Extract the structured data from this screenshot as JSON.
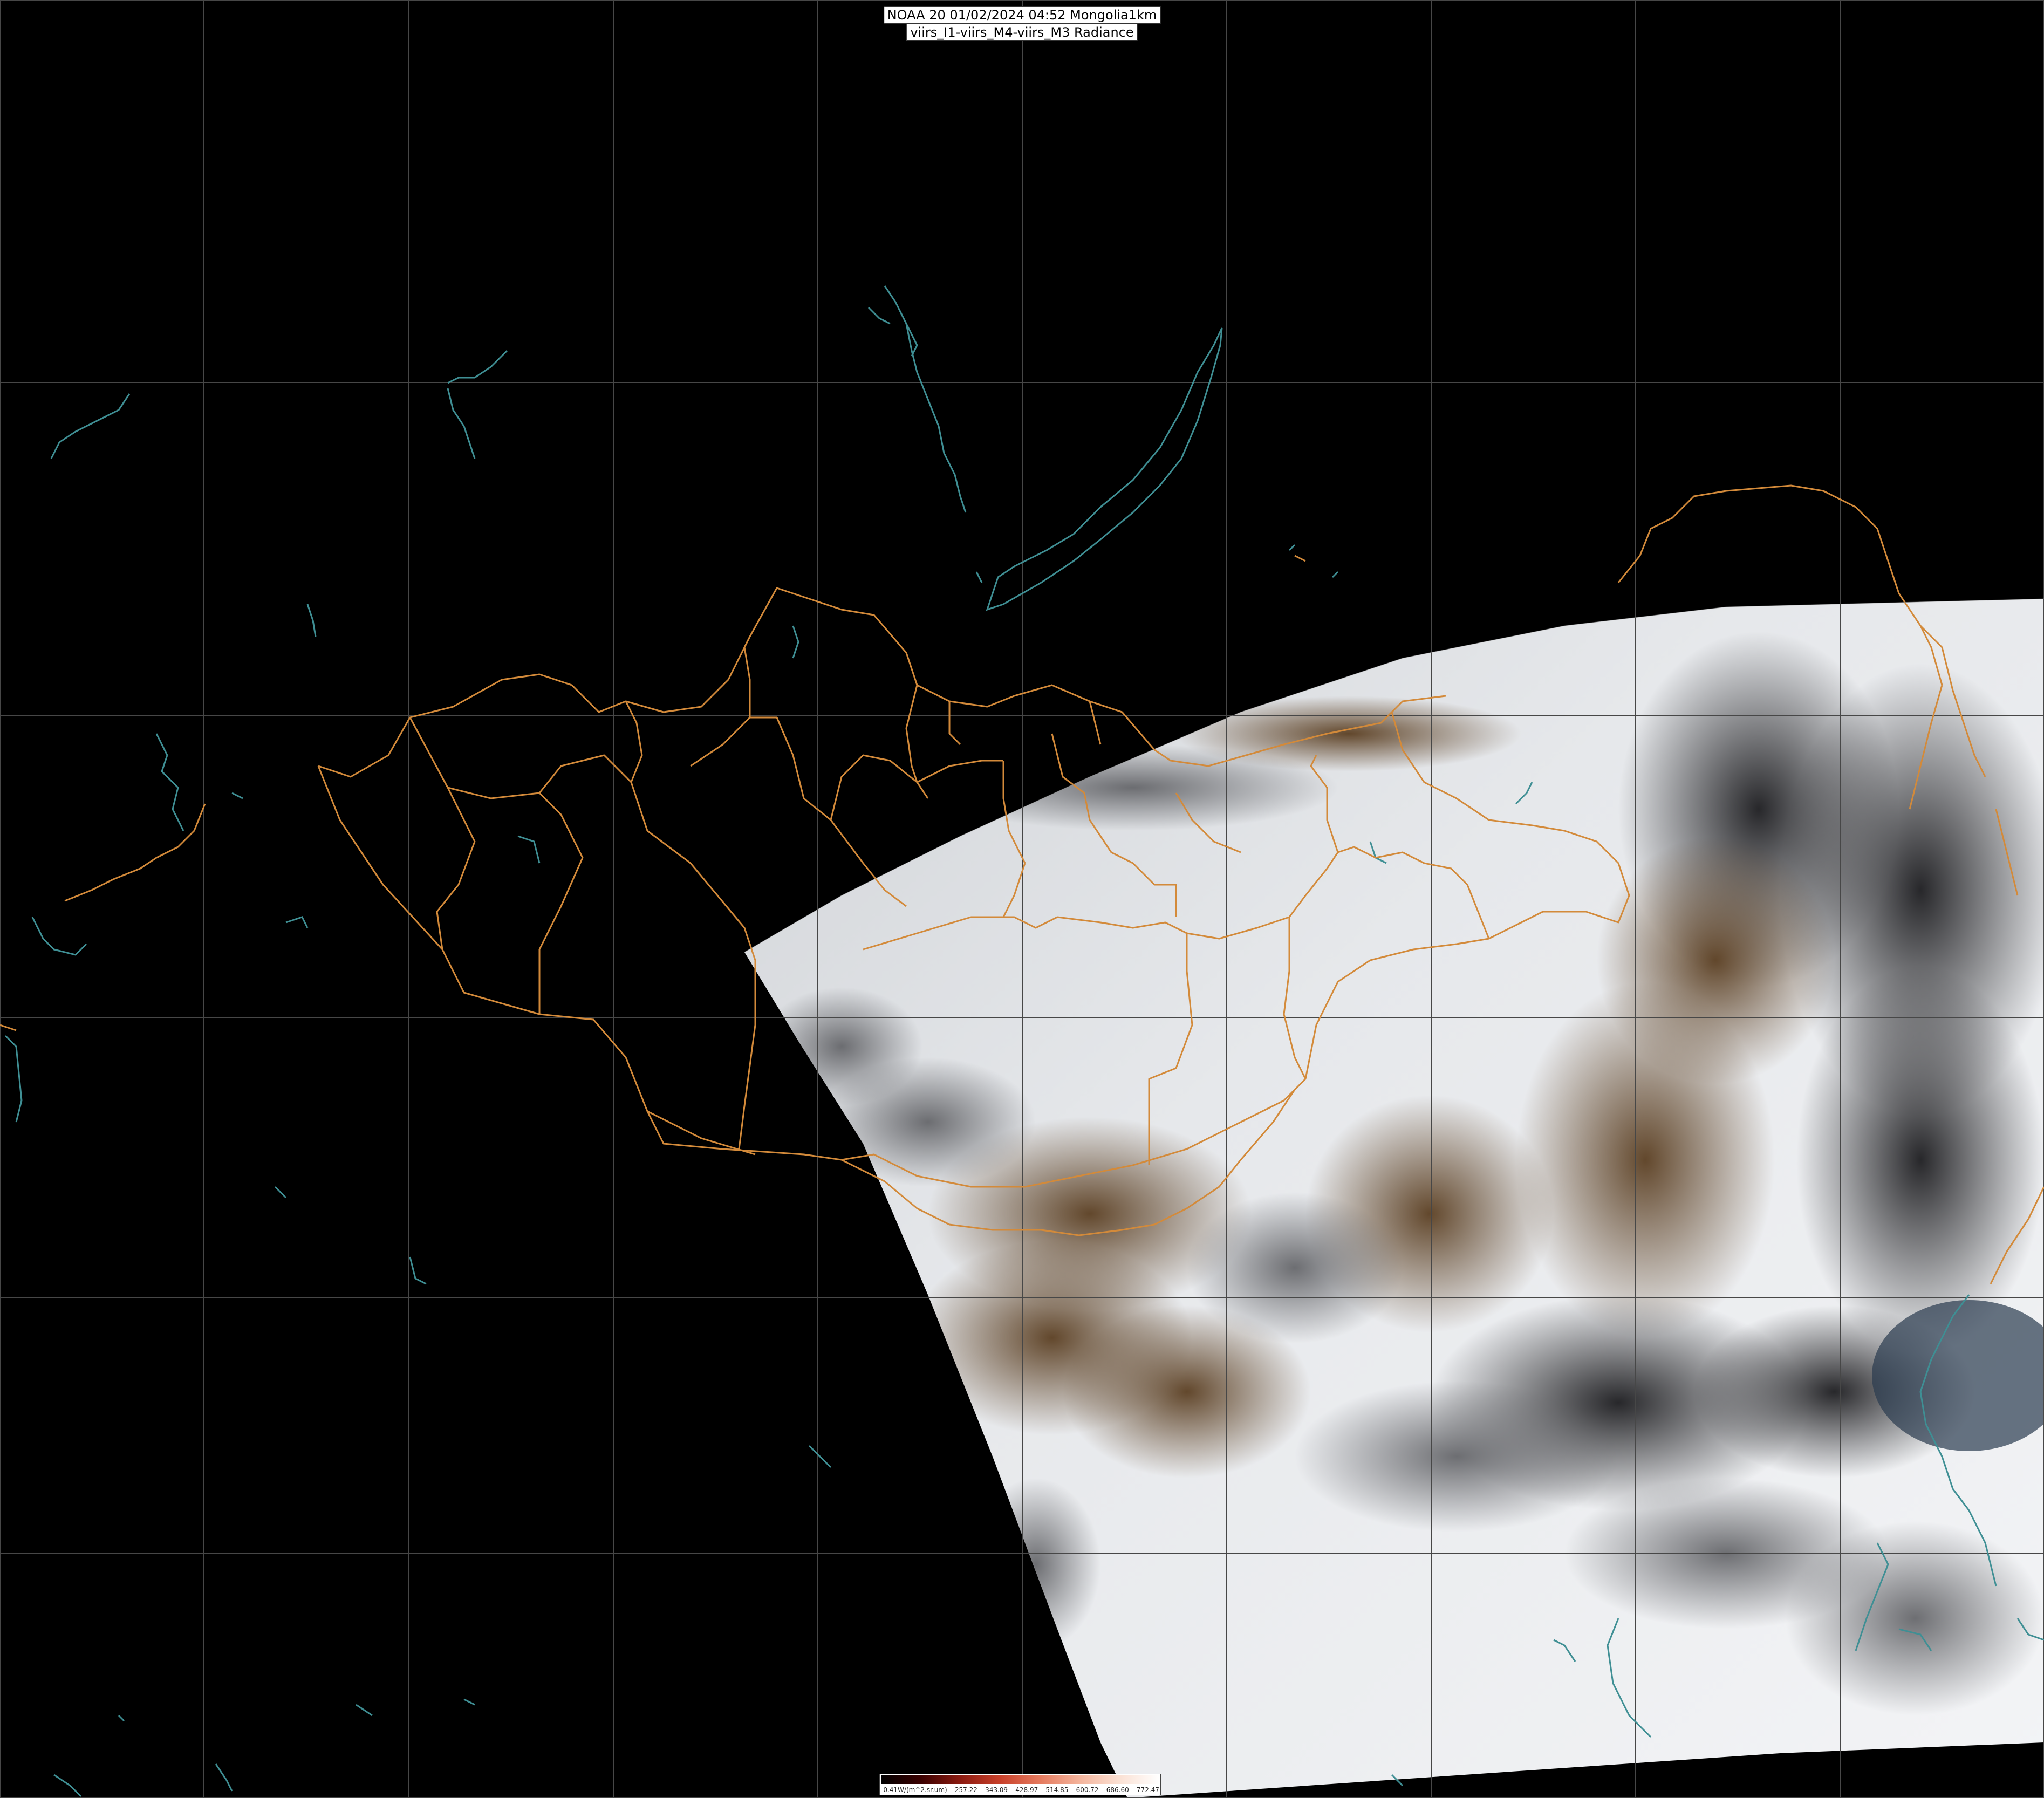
{
  "title": {
    "line1": "NOAA 20 01/02/2024 04:52 Mongolia1km",
    "line2": "viirs_I1-viirs_M4-viirs_M3 Radiance"
  },
  "colorbar": {
    "unit_label": "-0.41W/(m^2.sr.um)",
    "ticks": [
      "257.22",
      "343.09",
      "428.97",
      "514.85",
      "600.72",
      "686.60",
      "772.47"
    ],
    "stops": [
      "#000000",
      "#3a0000",
      "#8b1a10",
      "#c8402a",
      "#e57a5e",
      "#f4b49c",
      "#fbe1d4",
      "#ffffff"
    ]
  },
  "colors": {
    "background": "#000000",
    "grid": "#4a4a4a",
    "borders": "#d38a3a",
    "coast": "#3f8f94",
    "snow": "#e9ebee",
    "land": "#5a4026"
  }
}
